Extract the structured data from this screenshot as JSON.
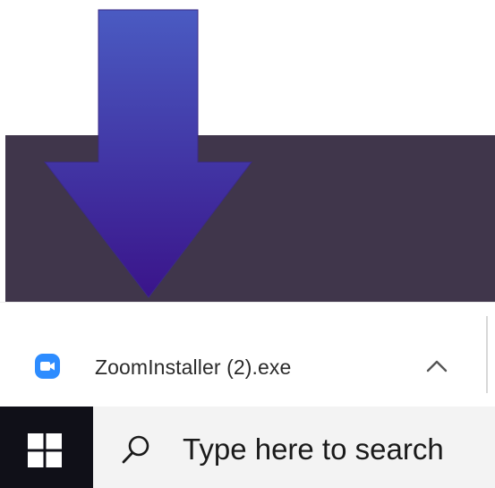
{
  "colors": {
    "dark_band": "#40364b",
    "arrow_top": "#4a5bc2",
    "arrow_bottom": "#3a148a",
    "zoom_blue": "#2d8cff",
    "taskbar": "#f3f3f3",
    "start_button": "#101018"
  },
  "annotation": {
    "icon": "down-arrow-icon"
  },
  "download_bar": {
    "item": {
      "file_name": "ZoomInstaller (2).exe",
      "icon": "zoom-app-icon",
      "menu_icon": "chevron-up-icon"
    }
  },
  "taskbar": {
    "start_icon": "windows-logo-icon",
    "search": {
      "icon": "search-icon",
      "placeholder": "Type here to search"
    }
  }
}
